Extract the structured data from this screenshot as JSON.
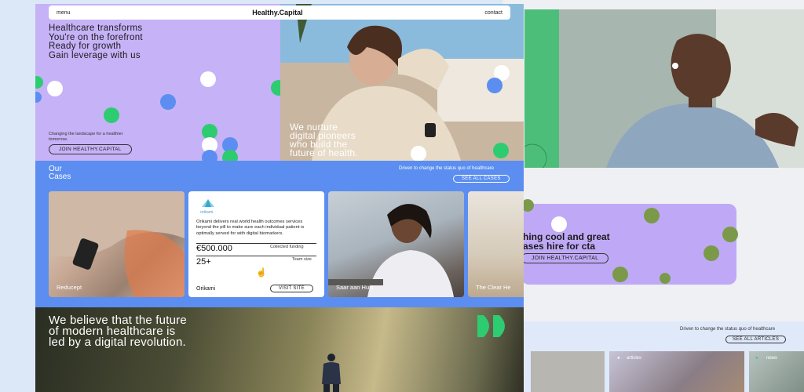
{
  "nav": {
    "menu": "menu",
    "logo": "Healthy.Capital",
    "contact": "contact"
  },
  "hero": {
    "headline": [
      "Healthcare transforms",
      "You're on the forefront",
      "Ready for growth",
      "Gain leverage with us"
    ],
    "small_text": "Changing the landscape for a healthier tomorrow.",
    "cta": "JOIN HEALTHY.CAPITAL",
    "overlay": [
      "We nurture",
      "digital pioneers",
      "who build the",
      "future of health."
    ]
  },
  "cases": {
    "title": [
      "Our",
      "Cases"
    ],
    "note": "Driven to change the status quo of healthcare",
    "see_all": "SEE ALL CASES",
    "cards": [
      {
        "name": "Reducept"
      },
      {
        "name": "Orikami",
        "logo_text": "orikami",
        "description": "Orikami delivers real world health outcomes services beyond the pill to make sure each individual patient is optimally served for with digital biomarkers.",
        "funding": "€500.000",
        "funding_label": "Collected funding",
        "team": "25+",
        "team_label": "Team size",
        "visit": "VISIT SITE"
      },
      {
        "name": "Saar aan Huis"
      },
      {
        "name": "The Clear He"
      }
    ]
  },
  "future": {
    "text": [
      "We believe that the future",
      "of modern healthcare is",
      "led by a digital revolution."
    ]
  },
  "background_page": {
    "cta_text": [
      "hing cool and great",
      "ases hire for cta"
    ],
    "cta_button": "JOIN HEALTHY.CAPITAL",
    "note": "Driven to change the status quo of healthcare",
    "see_all": "SEE ALL ARTICLES",
    "tag_articles": "articles",
    "tag_news": "news"
  },
  "colors": {
    "lavender": "#c6b2f7",
    "blue": "#5b8ef0",
    "green": "#2ecc71",
    "olive": "#7a9a4a"
  }
}
